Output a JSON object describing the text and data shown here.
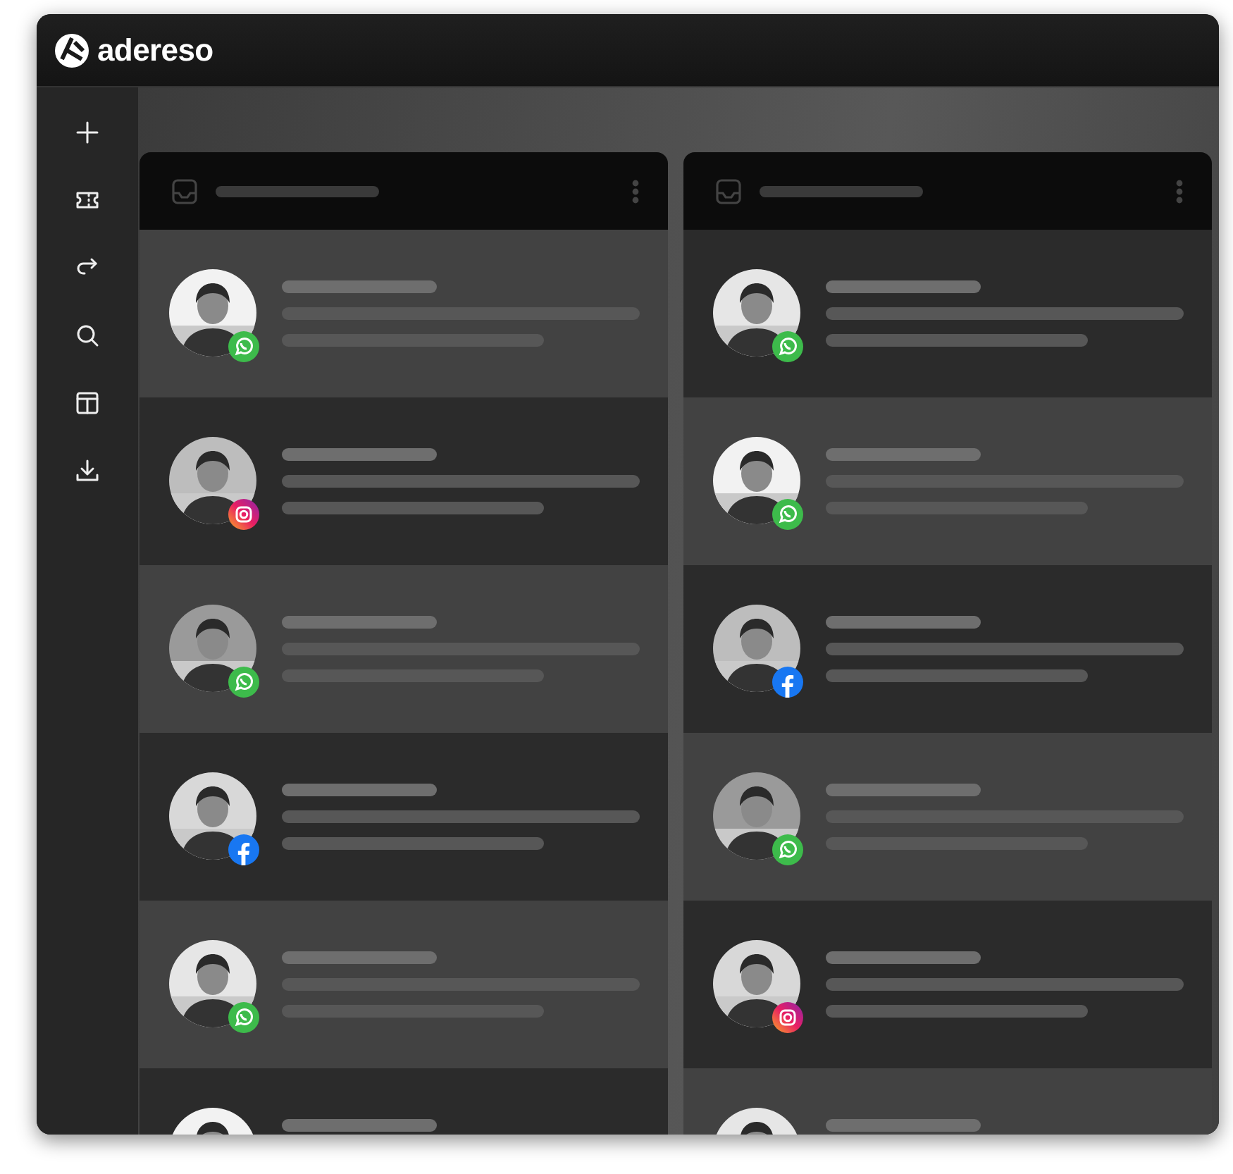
{
  "logo": {
    "text": "adereso"
  },
  "sidebar": {
    "items": [
      {
        "kind": "plus"
      },
      {
        "kind": "ticket"
      },
      {
        "kind": "redirect"
      },
      {
        "kind": "search"
      },
      {
        "kind": "layout"
      },
      {
        "kind": "download"
      }
    ]
  },
  "columns": [
    {
      "conversations": [
        {
          "kind": "whatsapp"
        },
        {
          "kind": "instagram"
        },
        {
          "kind": "whatsapp"
        },
        {
          "kind": "facebook"
        },
        {
          "kind": "whatsapp"
        },
        {
          "kind": "plain"
        }
      ]
    },
    {
      "conversations": [
        {
          "kind": "whatsapp"
        },
        {
          "kind": "whatsapp"
        },
        {
          "kind": "facebook"
        },
        {
          "kind": "whatsapp"
        },
        {
          "kind": "instagram"
        },
        {
          "kind": "plain"
        }
      ]
    }
  ]
}
